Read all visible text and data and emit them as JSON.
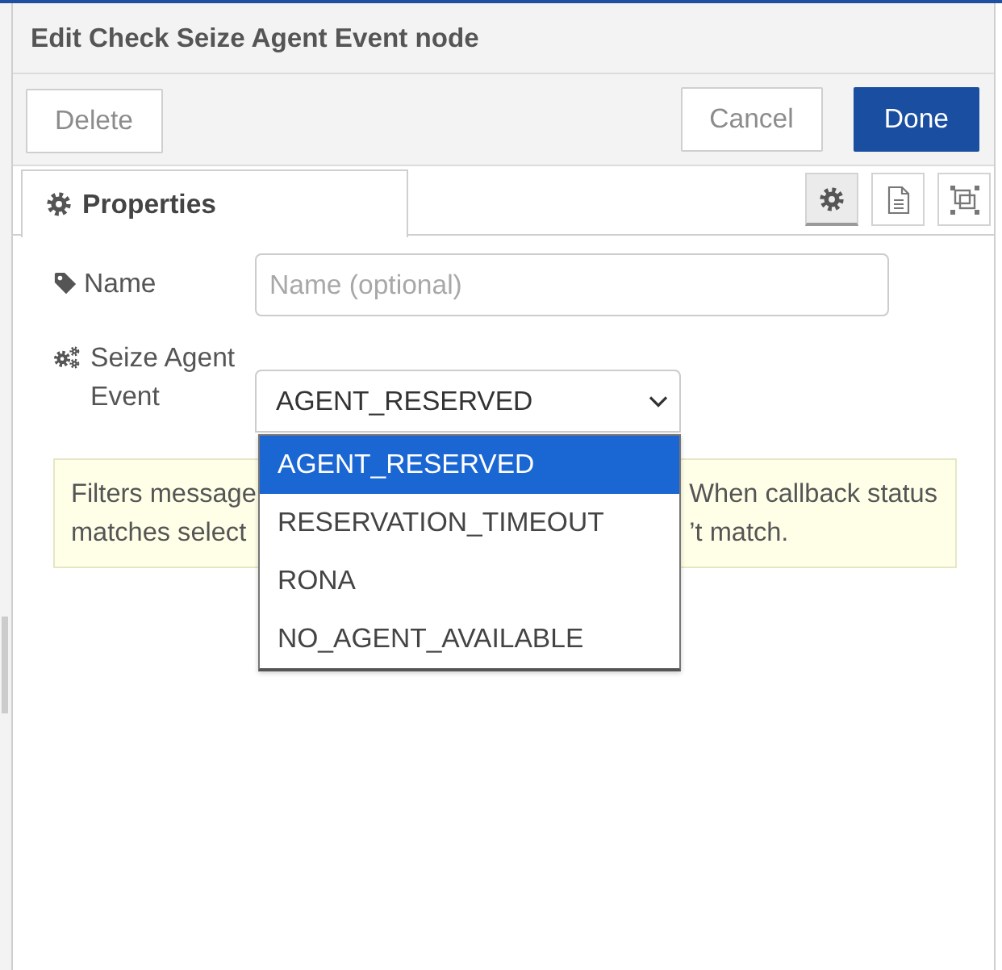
{
  "dialog": {
    "title": "Edit Check Seize Agent Event node"
  },
  "toolbar": {
    "left_buttons": [
      {
        "label": "Delete",
        "kind": "default"
      }
    ],
    "right_buttons": [
      {
        "label": "Cancel",
        "kind": "default"
      },
      {
        "label": "Done",
        "kind": "primary"
      }
    ]
  },
  "tabs": [
    {
      "label": "Properties",
      "selected": true
    }
  ],
  "icon_tabs": [
    {
      "selected": true
    },
    {
      "selected": false
    },
    {
      "selected": false
    }
  ],
  "fields": [
    {
      "kind": "text",
      "label": "Name",
      "placeholder": "Name (optional)"
    },
    {
      "kind": "select",
      "label": "Seize Agent Event",
      "value": "AGENT_RESERVED",
      "expanded": true,
      "options": [
        {
          "label": "AGENT_RESERVED",
          "selected": true
        },
        {
          "label": "RESERVATION_TIMEOUT",
          "selected": false
        },
        {
          "label": "RONA",
          "selected": false
        },
        {
          "label": "NO_AGENT_AVAILABLE",
          "selected": false
        }
      ]
    }
  ],
  "tip": {
    "left_fragments": [
      "Filters message",
      "matches select"
    ],
    "right_fragments": [
      "When callback status",
      "’t match."
    ]
  }
}
